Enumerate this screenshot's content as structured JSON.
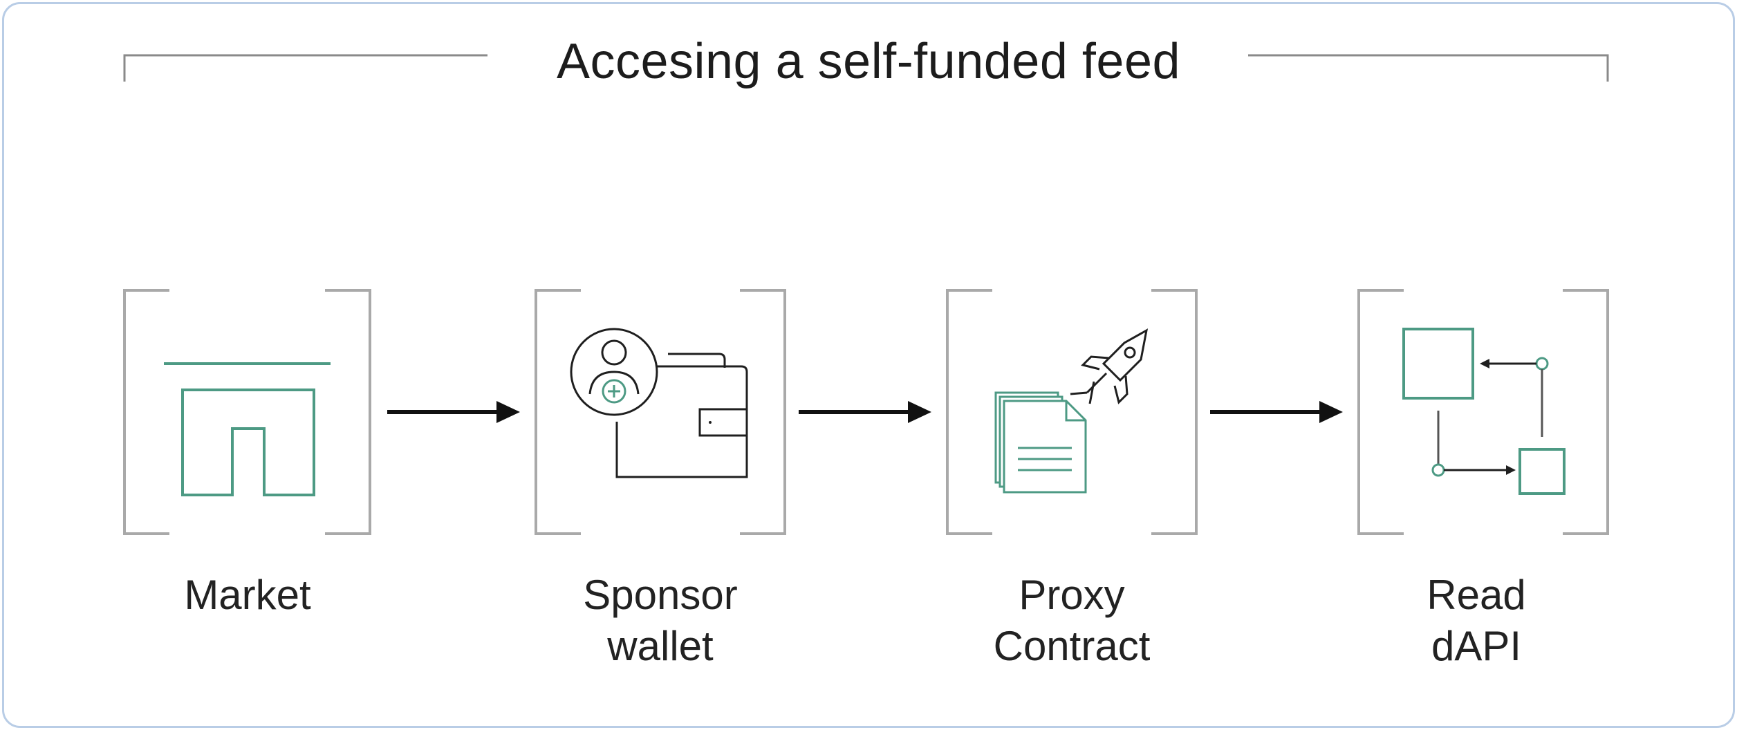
{
  "title": "Accesing a self-funded feed",
  "steps": [
    {
      "icon": "market-icon",
      "lines": [
        "Market",
        ""
      ]
    },
    {
      "icon": "sponsor-wallet-icon",
      "lines": [
        "Sponsor",
        "wallet"
      ]
    },
    {
      "icon": "proxy-contract-icon",
      "lines": [
        "Proxy",
        "Contract"
      ]
    },
    {
      "icon": "read-dapi-icon",
      "lines": [
        "Read",
        "dAPI"
      ]
    }
  ],
  "colors": {
    "accent": "#4d9a84",
    "ink": "#1f1f1f",
    "bracket": "#a9a9a9",
    "border": "#b9cde6"
  }
}
